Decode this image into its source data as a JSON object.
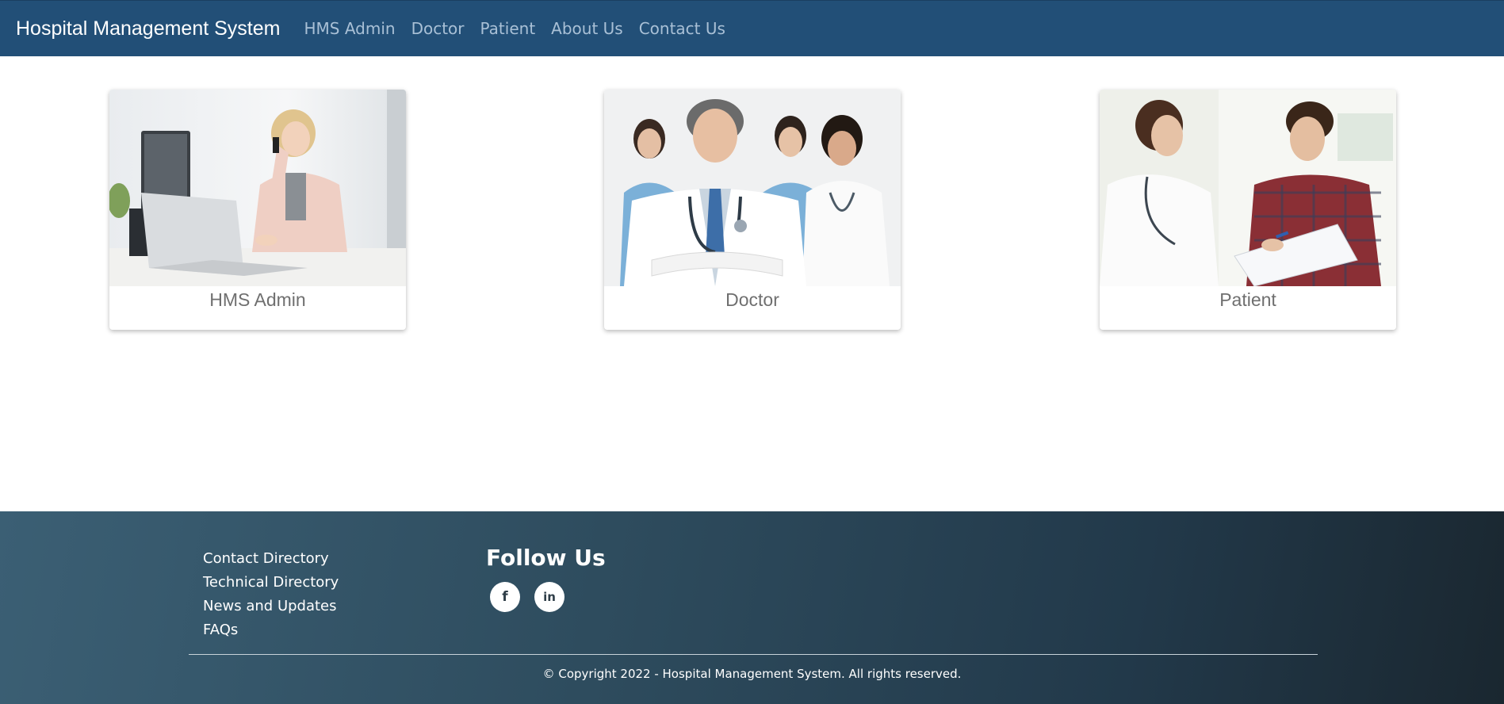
{
  "navbar": {
    "brand": "Hospital Management System",
    "links": [
      "HMS Admin",
      "Doctor",
      "Patient",
      "About Us",
      "Contact Us"
    ],
    "background": "#224f77"
  },
  "cards": [
    {
      "title": "HMS Admin",
      "image": "admin-at-laptop-photo"
    },
    {
      "title": "Doctor",
      "image": "doctor-and-nurses-photo"
    },
    {
      "title": "Patient",
      "image": "doctor-with-patient-photo"
    }
  ],
  "footer": {
    "links": [
      "Contact Directory",
      "Technical Directory",
      "News and Updates",
      "FAQs"
    ],
    "follow_title": "Follow Us",
    "social": [
      {
        "icon": "facebook-icon",
        "glyph": "f"
      },
      {
        "icon": "linkedin-icon",
        "glyph": "in"
      }
    ],
    "copyright": "© Copyright 2022 - Hospital Management System. All rights reserved."
  }
}
